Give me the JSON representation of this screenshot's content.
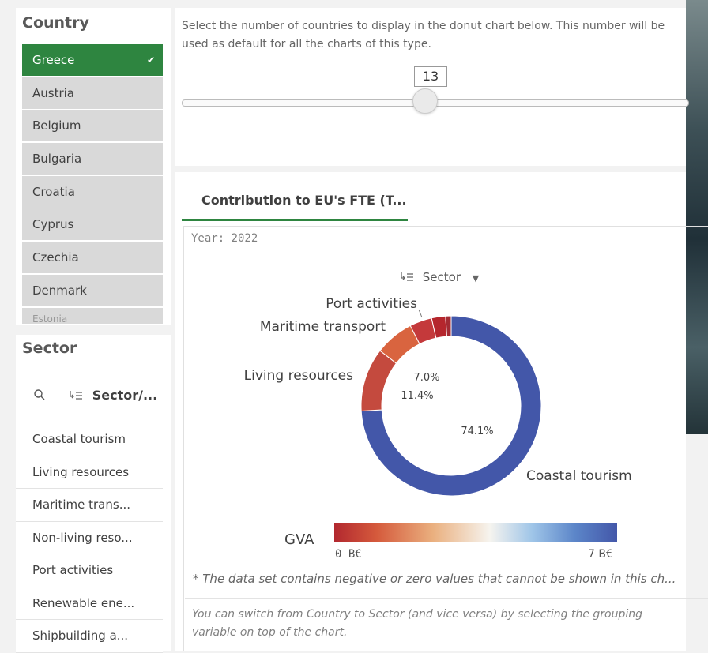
{
  "country_filter": {
    "title": "Country",
    "items": [
      {
        "label": "Greece",
        "selected": true
      },
      {
        "label": "Austria"
      },
      {
        "label": "Belgium"
      },
      {
        "label": "Bulgaria"
      },
      {
        "label": "Croatia"
      },
      {
        "label": "Cyprus"
      },
      {
        "label": "Czechia"
      },
      {
        "label": "Denmark"
      },
      {
        "label": "Estonia"
      }
    ]
  },
  "sector_filter": {
    "title": "Sector",
    "header_label": "Sector/...",
    "items": [
      "Coastal tourism",
      "Living resources",
      "Maritime trans...",
      "Non-living reso...",
      "Port activities",
      "Renewable ene...",
      "Shipbuilding a..."
    ]
  },
  "slider": {
    "description": "Select the number of countries to display in the donut chart below. This number will be used as default for all the charts of this type.",
    "value": "13"
  },
  "chart_tab": {
    "label": "Contribution to EU's FTE (T..."
  },
  "chart_header": {
    "year": "Year: 2022",
    "dimension_selector": "Sector"
  },
  "chart_data": {
    "type": "pie",
    "style": "donut",
    "slices": [
      {
        "label": "Coastal tourism",
        "value": 74.1,
        "color": "#4357a9"
      },
      {
        "label": "Living resources",
        "value": 11.4,
        "color": "#c44a3e"
      },
      {
        "label": "Maritime transport",
        "value": 7.0,
        "color": "#d9643f"
      },
      {
        "label": "Port activities",
        "value": 4.0,
        "color": "#c4393b"
      },
      {
        "label": "",
        "value": 2.5,
        "color": "#b5262d"
      },
      {
        "label": "",
        "value": 1.0,
        "color": "#a32a33"
      }
    ],
    "data_labels": [
      "74.1%",
      "11.4%",
      "7.0%"
    ]
  },
  "legend": {
    "label": "GVA",
    "min": "0 B€",
    "max": "7 B€"
  },
  "notes": {
    "warning": "* The data set contains negative or zero values that cannot be shown in this ch...",
    "info": "You can switch from Country to Sector (and vice versa) by selecting the grouping variable on top of the chart."
  },
  "colors": {
    "accent": "#2e8540",
    "selected_item": "#2e8540"
  }
}
